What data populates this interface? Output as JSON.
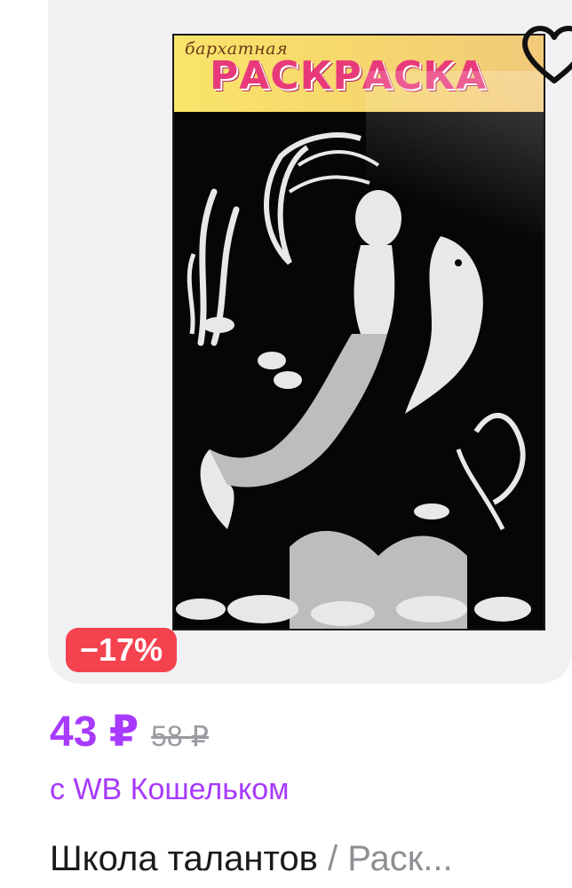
{
  "product": {
    "image_alt_text": {
      "banner_subtitle": "бархатная",
      "banner_title": "РАСКРАСКА"
    },
    "favorite_icon": "heart-outline-icon",
    "discount_badge": "−17%",
    "price_current": "43 ₽",
    "price_old": "58 ₽",
    "wallet_note": "с WB Кошельком",
    "brand": "Школа талантов",
    "title_separator": " / ",
    "category": "Раск..."
  },
  "colors": {
    "accent_purple": "#a73afd",
    "discount_red": "#f5424f",
    "panel_bg": "#f1f1f4",
    "muted_gray": "#8e8e94"
  }
}
